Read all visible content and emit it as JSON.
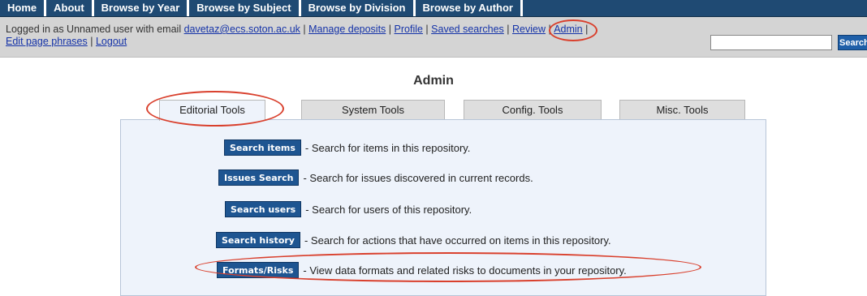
{
  "topnav": {
    "items": [
      "Home",
      "About",
      "Browse by Year",
      "Browse by Subject",
      "Browse by Division",
      "Browse by Author"
    ]
  },
  "login": {
    "prefix": "Logged in as Unnamed user with email ",
    "email": "davetaz@ecs.soton.ac.uk",
    "links": [
      "Manage deposits",
      "Profile",
      "Saved searches",
      "Review",
      "Admin",
      "Edit page phrases",
      "Logout"
    ],
    "separator": " | "
  },
  "search": {
    "button_label": "Search",
    "value": ""
  },
  "page": {
    "title": "Admin"
  },
  "tabs": [
    "Editorial Tools",
    "System Tools",
    "Config. Tools",
    "Misc. Tools"
  ],
  "tools": [
    {
      "label": "Search items",
      "description": "- Search for items in this repository."
    },
    {
      "label": "Issues Search",
      "description": "- Search for issues discovered in current records."
    },
    {
      "label": "Search users",
      "description": "- Search for users of this repository."
    },
    {
      "label": "Search history",
      "description": "- Search for actions that have occurred on items in this repository."
    },
    {
      "label": "Formats/Risks",
      "description": "- View data formats and related risks to documents in your repository."
    }
  ],
  "colors": {
    "nav_bg": "#1f4a73",
    "button_bg": "#1e5591",
    "highlight": "#d9402d",
    "panel_bg": "#eef3fb"
  }
}
